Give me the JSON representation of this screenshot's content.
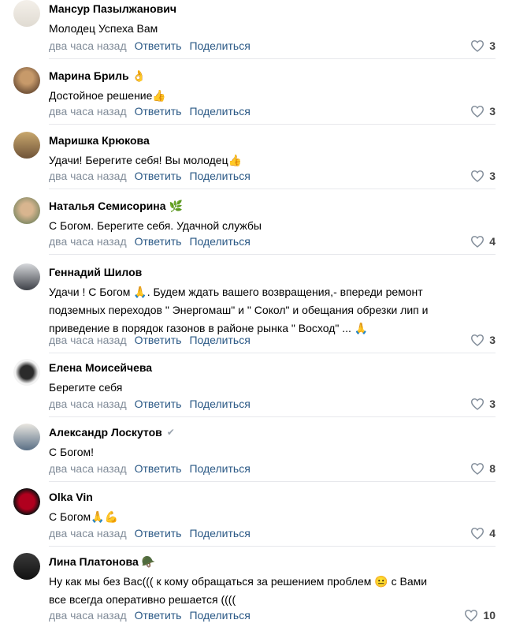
{
  "comments": [
    {
      "author": "Мансур Пазылжанович",
      "emoji": "",
      "lines": [
        "Молодец Успеха Вам"
      ],
      "time": "два часа назад",
      "reply": "Ответить",
      "share": "Поделиться",
      "likes": "3"
    },
    {
      "author": "Марина Бриль",
      "emoji": "👌",
      "lines": [
        "Достойное решение👍"
      ],
      "time": "два часа назад",
      "reply": "Ответить",
      "share": "Поделиться",
      "likes": "3"
    },
    {
      "author": "Маришка Крюкова",
      "emoji": "",
      "lines": [
        "Удачи! Берегите себя! Вы молодец👍"
      ],
      "time": "два часа назад",
      "reply": "Ответить",
      "share": "Поделиться",
      "likes": "3"
    },
    {
      "author": "Наталья Семисорина",
      "emoji": "🌿",
      "lines": [
        "С Богом. Берегите себя. Удачной службы"
      ],
      "time": "два часа назад",
      "reply": "Ответить",
      "share": "Поделиться",
      "likes": "4"
    },
    {
      "author": "Геннадий Шилов",
      "emoji": "",
      "lines": [
        "Удачи ! С Богом 🙏. Будем ждать вашего возвращения,- впереди ремонт",
        "подземных переходов \" Энергомаш\" и \" Сокол\" и обещания обрезки лип и",
        "приведение в порядок газонов в районе рынка \" Восход\" ... 🙏"
      ],
      "time": "два часа назад",
      "reply": "Ответить",
      "share": "Поделиться",
      "likes": "3"
    },
    {
      "author": "Елена Моисейчева",
      "emoji": "",
      "lines": [
        "Берегите себя"
      ],
      "time": "два часа назад",
      "reply": "Ответить",
      "share": "Поделиться",
      "likes": "3"
    },
    {
      "author": "Александр Лоскутов",
      "emoji": "",
      "verified": "✔",
      "lines": [
        "С Богом!"
      ],
      "time": "два часа назад",
      "reply": "Ответить",
      "share": "Поделиться",
      "likes": "8"
    },
    {
      "author": "Olka Vin",
      "emoji": "",
      "lines": [
        "С Богом🙏💪"
      ],
      "time": "два часа назад",
      "reply": "Ответить",
      "share": "Поделиться",
      "likes": "4"
    },
    {
      "author": "Лина Платонова",
      "emoji": "🪖",
      "lines": [
        "Ну как мы без Вас((( к кому обращаться за решением проблем 😐 с Вами",
        "все всегда оперативно решается (((("
      ],
      "time": "два часа назад",
      "reply": "Ответить",
      "share": "Поделиться",
      "likes": "10"
    }
  ],
  "colors": {
    "meta": "#818c99",
    "link": "#2a5885",
    "divider": "#e7e8ec"
  },
  "icons": {
    "like": "heart-outline-icon"
  }
}
